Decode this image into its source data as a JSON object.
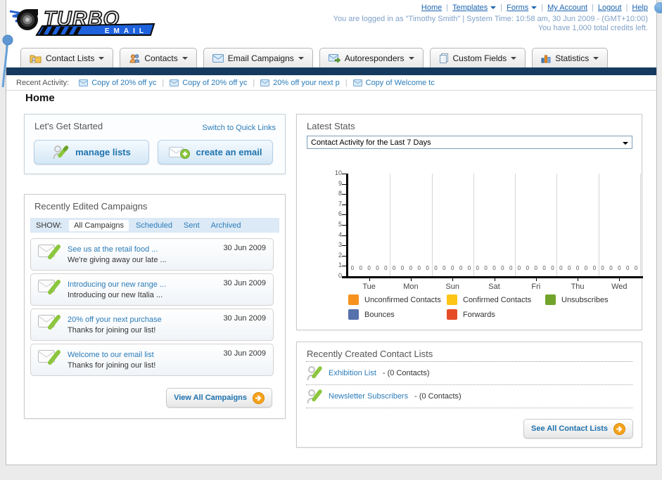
{
  "header": {
    "logo": {
      "brand": "TURBO",
      "sub": "EMAIL"
    },
    "nav_links": [
      {
        "label": "Home"
      },
      {
        "label": "Templates"
      },
      {
        "label": "Forms"
      },
      {
        "label": "My Account"
      },
      {
        "label": "Logout"
      },
      {
        "label": "Help"
      }
    ],
    "login_info": "You are logged in as \"Timothy Smith\" | System Time: 10:58 am, 30 Jun 2009 - (GMT+10:00)",
    "credits_info": "You have 1,000 total credits left."
  },
  "nav_tabs": [
    {
      "label": "Contact Lists"
    },
    {
      "label": "Contacts"
    },
    {
      "label": "Email Campaigns"
    },
    {
      "label": "Autoresponders"
    },
    {
      "label": "Custom Fields"
    },
    {
      "label": "Statistics"
    }
  ],
  "recent_activity": {
    "label": "Recent Activity:",
    "items": [
      {
        "label": "Copy of 20% off yc"
      },
      {
        "label": "Copy of 20% off yc"
      },
      {
        "label": "20% off your next p"
      },
      {
        "label": "Copy of Welcome tc"
      }
    ]
  },
  "page_title": "Home",
  "get_started": {
    "title": "Let's Get Started",
    "switch_link": "Switch to Quick Links",
    "manage_lists_label": "manage lists",
    "create_email_label": "create an email"
  },
  "campaigns": {
    "title": "Recently Edited Campaigns",
    "show_label": "SHOW:",
    "filters": [
      {
        "label": "All Campaigns",
        "active": true
      },
      {
        "label": "Scheduled",
        "active": false
      },
      {
        "label": "Sent",
        "active": false
      },
      {
        "label": "Archived",
        "active": false
      }
    ],
    "items": [
      {
        "title": "See us at the retail food ...",
        "subtitle": "We're giving away our late ...",
        "date": "30 Jun 2009"
      },
      {
        "title": "Introducing our new range ...",
        "subtitle": "Introducing our new Italia ...",
        "date": "30 Jun 2009"
      },
      {
        "title": "20% off your next purchase",
        "subtitle": "Thanks for joining our list!",
        "date": "30 Jun 2009"
      },
      {
        "title": "Welcome to our email list",
        "subtitle": "Thanks for joining our list!",
        "date": "30 Jun 2009"
      }
    ],
    "view_all_label": "View All Campaigns"
  },
  "latest_stats": {
    "title": "Latest Stats",
    "selected_option": "Contact Activity for the Last 7 Days"
  },
  "chart_data": {
    "type": "bar",
    "title": "Contact Activity for the Last 7 Days",
    "categories": [
      "Tue",
      "Mon",
      "Sun",
      "Sat",
      "Fri",
      "Thu",
      "Wed"
    ],
    "series": [
      {
        "name": "Unconfirmed Contacts",
        "color": "#f6921e",
        "values": [
          0,
          0,
          0,
          0,
          0,
          0,
          0
        ]
      },
      {
        "name": "Confirmed Contacts",
        "color": "#fdc616",
        "values": [
          0,
          0,
          0,
          0,
          0,
          0,
          0
        ]
      },
      {
        "name": "Unsubscribes",
        "color": "#72a42b",
        "values": [
          0,
          0,
          0,
          0,
          0,
          0,
          0
        ]
      },
      {
        "name": "Bounces",
        "color": "#5671ac",
        "values": [
          0,
          0,
          0,
          0,
          0,
          0,
          0
        ]
      },
      {
        "name": "Forwards",
        "color": "#e74c28",
        "values": [
          0,
          0,
          0,
          0,
          0,
          0,
          0
        ]
      }
    ],
    "xlabel": "",
    "ylabel": "",
    "ylim": [
      0,
      10
    ],
    "yticks": [
      0,
      1,
      2,
      3,
      4,
      5,
      6,
      7,
      8,
      9,
      10
    ],
    "grid": "vertical",
    "legend_position": "bottom"
  },
  "contact_lists": {
    "title": "Recently Created Contact Lists",
    "items": [
      {
        "name": "Exhibition List",
        "suffix": " - (0 Contacts)"
      },
      {
        "name": "Newsletter Subscribers",
        "suffix": " - (0 Contacts)"
      }
    ],
    "see_all_label": "See All Contact Lists"
  },
  "colors": {
    "navy_bar": "#163a5f",
    "link_blue": "#2b7cb9",
    "button_blue_text": "#1f73ae",
    "accent_orange": "#f6a31d",
    "annotation_blue": "#5d96d2"
  }
}
